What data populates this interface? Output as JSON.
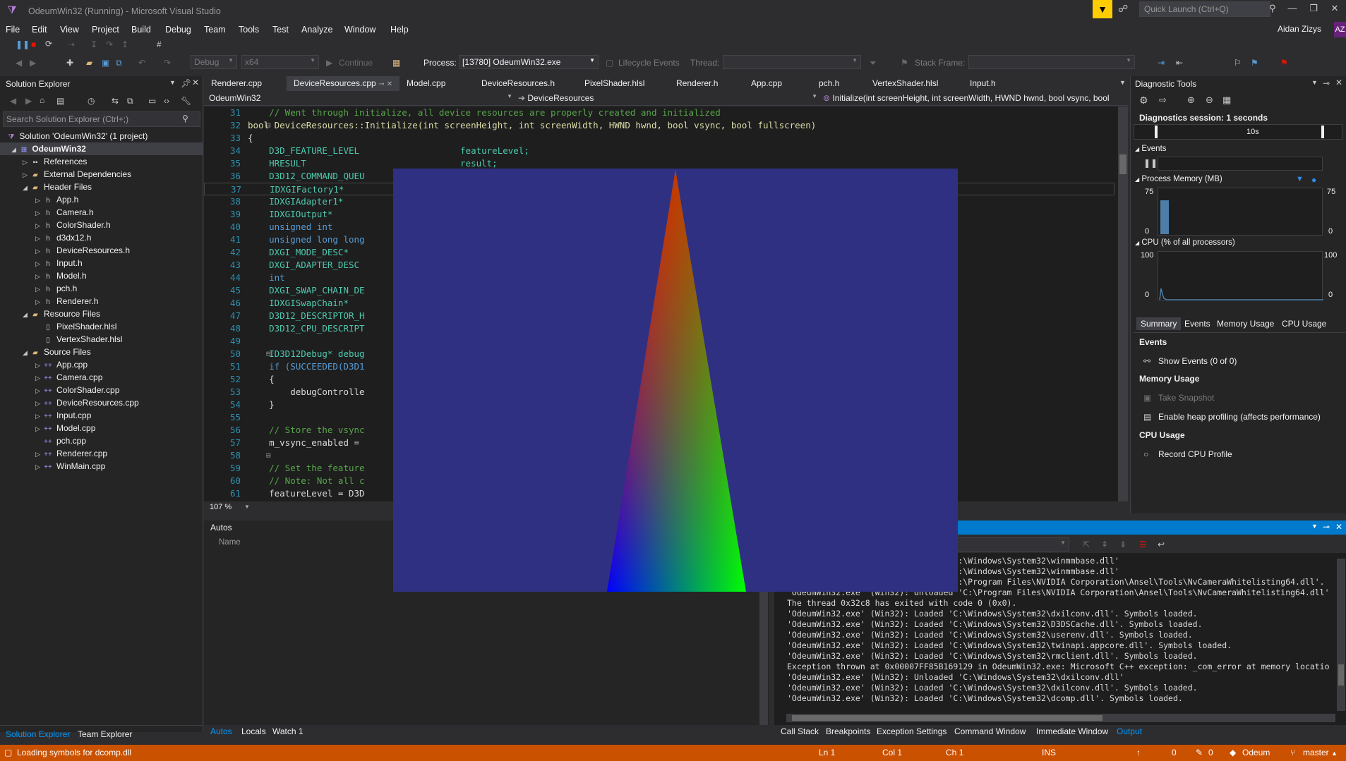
{
  "window": {
    "title": "OdeumWin32 (Running) - Microsoft Visual Studio",
    "quick_launch_placeholder": "Quick Launch (Ctrl+Q)",
    "user_name": "Aidan Zizys",
    "user_initials": "AZ"
  },
  "menu": [
    "File",
    "Edit",
    "View",
    "Project",
    "Build",
    "Debug",
    "Team",
    "Tools",
    "Test",
    "Analyze",
    "Window",
    "Help"
  ],
  "toolbar": {
    "config": "Debug",
    "platform": "x64",
    "continue_label": "Continue",
    "process_label": "Process:",
    "process_value": "[13780] OdeumWin32.exe",
    "lifecycle_label": "Lifecycle Events",
    "thread_label": "Thread:",
    "stack_frame_label": "Stack Frame:"
  },
  "solution_explorer": {
    "title": "Solution Explorer",
    "search_placeholder": "Search Solution Explorer (Ctrl+;)",
    "solution_label": "Solution 'OdeumWin32' (1 project)",
    "project_label": "OdeumWin32",
    "items": [
      {
        "label": "References",
        "indent": 2,
        "icon": "references-icon",
        "arrow": "▷"
      },
      {
        "label": "External Dependencies",
        "indent": 2,
        "icon": "external-deps-icon",
        "arrow": "▷"
      },
      {
        "label": "Header Files",
        "indent": 2,
        "icon": "folder-icon",
        "arrow": "◢"
      },
      {
        "label": "App.h",
        "indent": 3,
        "icon": "header-file-icon",
        "arrow": "▷"
      },
      {
        "label": "Camera.h",
        "indent": 3,
        "icon": "header-file-icon",
        "arrow": "▷"
      },
      {
        "label": "ColorShader.h",
        "indent": 3,
        "icon": "header-file-icon",
        "arrow": "▷"
      },
      {
        "label": "d3dx12.h",
        "indent": 3,
        "icon": "header-file-icon",
        "arrow": "▷"
      },
      {
        "label": "DeviceResources.h",
        "indent": 3,
        "icon": "header-file-icon",
        "arrow": "▷"
      },
      {
        "label": "Input.h",
        "indent": 3,
        "icon": "header-file-icon",
        "arrow": "▷"
      },
      {
        "label": "Model.h",
        "indent": 3,
        "icon": "header-file-icon",
        "arrow": "▷"
      },
      {
        "label": "pch.h",
        "indent": 3,
        "icon": "header-file-icon",
        "arrow": "▷"
      },
      {
        "label": "Renderer.h",
        "indent": 3,
        "icon": "header-file-icon",
        "arrow": "▷"
      },
      {
        "label": "Resource Files",
        "indent": 2,
        "icon": "folder-icon",
        "arrow": "◢"
      },
      {
        "label": "PixelShader.hlsl",
        "indent": 3,
        "icon": "hlsl-file-icon",
        "arrow": ""
      },
      {
        "label": "VertexShader.hlsl",
        "indent": 3,
        "icon": "hlsl-file-icon",
        "arrow": ""
      },
      {
        "label": "Source Files",
        "indent": 2,
        "icon": "folder-icon",
        "arrow": "◢"
      },
      {
        "label": "App.cpp",
        "indent": 3,
        "icon": "cpp-file-icon",
        "arrow": "▷"
      },
      {
        "label": "Camera.cpp",
        "indent": 3,
        "icon": "cpp-file-icon",
        "arrow": "▷"
      },
      {
        "label": "ColorShader.cpp",
        "indent": 3,
        "icon": "cpp-file-icon",
        "arrow": "▷"
      },
      {
        "label": "DeviceResources.cpp",
        "indent": 3,
        "icon": "cpp-file-icon",
        "arrow": "▷"
      },
      {
        "label": "Input.cpp",
        "indent": 3,
        "icon": "cpp-file-icon",
        "arrow": "▷"
      },
      {
        "label": "Model.cpp",
        "indent": 3,
        "icon": "cpp-file-icon",
        "arrow": "▷"
      },
      {
        "label": "pch.cpp",
        "indent": 3,
        "icon": "cpp-file-icon",
        "arrow": ""
      },
      {
        "label": "Renderer.cpp",
        "indent": 3,
        "icon": "cpp-file-icon",
        "arrow": "▷"
      },
      {
        "label": "WinMain.cpp",
        "indent": 3,
        "icon": "cpp-file-icon",
        "arrow": "▷"
      }
    ],
    "bottom_tabs": [
      "Solution Explorer",
      "Team Explorer"
    ]
  },
  "editor": {
    "tabs": [
      "Renderer.cpp",
      "DeviceResources.cpp",
      "Model.cpp",
      "DeviceResources.h",
      "PixelShader.hlsl",
      "Renderer.h",
      "App.cpp",
      "pch.h",
      "VertexShader.hlsl",
      "Input.h"
    ],
    "active_tab": 1,
    "nav_project": "OdeumWin32",
    "nav_class": "DeviceResources",
    "nav_member": "Initialize(int screenHeight, int screenWidth, HWND hwnd, bool vsync, bool",
    "zoom": "107 %",
    "lines": [
      {
        "n": "31",
        "t": "    // Went through initialize, all device resources are properly created and initialized",
        "c": "cm"
      },
      {
        "n": "32",
        "t": "bool DeviceResources::Initialize(int screenHeight, int screenWidth, HWND hwnd, bool vsync, bool fullscreen)",
        "c": "sig"
      },
      {
        "n": "33",
        "t": "{",
        "c": ""
      },
      {
        "n": "34",
        "t": "    D3D_FEATURE_LEVEL                   featureLevel;",
        "c": "ty"
      },
      {
        "n": "35",
        "t": "    HRESULT                             result;",
        "c": "ty"
      },
      {
        "n": "36",
        "t": "    D3D12_COMMAND_QUEU",
        "c": "ty"
      },
      {
        "n": "37",
        "t": "    IDXGIFactory1*",
        "c": "ty"
      },
      {
        "n": "38",
        "t": "    IDXGIAdapter1*",
        "c": "ty"
      },
      {
        "n": "39",
        "t": "    IDXGIOutput*",
        "c": "ty"
      },
      {
        "n": "40",
        "t": "    unsigned int",
        "c": "kw"
      },
      {
        "n": "41",
        "t": "    unsigned long long",
        "c": "kw"
      },
      {
        "n": "42",
        "t": "    DXGI_MODE_DESC*",
        "c": "ty"
      },
      {
        "n": "43",
        "t": "    DXGI_ADAPTER_DESC",
        "c": "ty"
      },
      {
        "n": "44",
        "t": "    int",
        "c": "kw"
      },
      {
        "n": "45",
        "t": "    DXGI_SWAP_CHAIN_DE",
        "c": "ty"
      },
      {
        "n": "46",
        "t": "    IDXGISwapChain*",
        "c": "ty"
      },
      {
        "n": "47",
        "t": "    D3D12_DESCRIPTOR_H",
        "c": "ty"
      },
      {
        "n": "48",
        "t": "    D3D12_CPU_DESCRIPT",
        "c": "ty"
      },
      {
        "n": "49",
        "t": "",
        "c": ""
      },
      {
        "n": "50",
        "t": "    ID3D12Debug* debug",
        "c": "ty"
      },
      {
        "n": "51",
        "t": "    if (SUCCEEDED(D3D1",
        "c": "if"
      },
      {
        "n": "52",
        "t": "    {",
        "c": ""
      },
      {
        "n": "53",
        "t": "        debugControlle",
        "c": "mv"
      },
      {
        "n": "54",
        "t": "    }",
        "c": ""
      },
      {
        "n": "55",
        "t": "",
        "c": ""
      },
      {
        "n": "56",
        "t": "    // Store the vsync",
        "c": "cm"
      },
      {
        "n": "57",
        "t": "    m_vsync_enabled = ",
        "c": "mv"
      },
      {
        "n": "58",
        "t": "",
        "c": ""
      },
      {
        "n": "59",
        "t": "    // Set the feature",
        "c": "cm"
      },
      {
        "n": "60",
        "t": "    // Note: Not all c",
        "c": "cm"
      },
      {
        "n": "61",
        "t": "    featureLevel = D3D",
        "c": "mv"
      }
    ]
  },
  "autos": {
    "title": "Autos",
    "column_name": "Name",
    "bottom_tabs": [
      "Autos",
      "Locals",
      "Watch 1"
    ]
  },
  "output": {
    "lines": [
      "'OdeumWin32.exe' (Win32): Loaded 'C:\\Windows\\System32\\winmmbase.dll'",
      "'OdeumWin32.exe' (Win32): Loaded 'C:\\Windows\\System32\\winmmbase.dll'",
      "'OdeumWin32.exe' (Win32): Loaded 'C:\\Program Files\\NVIDIA Corporation\\Ansel\\Tools\\NvCameraWhitelisting64.dll'.",
      "'OdeumWin32.exe' (Win32): Unloaded 'C:\\Program Files\\NVIDIA Corporation\\Ansel\\Tools\\NvCameraWhitelisting64.dll'",
      "The thread 0x32c8 has exited with code 0 (0x0).",
      "'OdeumWin32.exe' (Win32): Loaded 'C:\\Windows\\System32\\dxilconv.dll'. Symbols loaded.",
      "'OdeumWin32.exe' (Win32): Loaded 'C:\\Windows\\System32\\D3DSCache.dll'. Symbols loaded.",
      "'OdeumWin32.exe' (Win32): Loaded 'C:\\Windows\\System32\\userenv.dll'. Symbols loaded.",
      "'OdeumWin32.exe' (Win32): Loaded 'C:\\Windows\\System32\\twinapi.appcore.dll'. Symbols loaded.",
      "'OdeumWin32.exe' (Win32): Loaded 'C:\\Windows\\System32\\rmclient.dll'. Symbols loaded.",
      "Exception thrown at 0x00007FF85B169129 in OdeumWin32.exe: Microsoft C++ exception: _com_error at memory locatio",
      "'OdeumWin32.exe' (Win32): Unloaded 'C:\\Windows\\System32\\dxilconv.dll'",
      "'OdeumWin32.exe' (Win32): Loaded 'C:\\Windows\\System32\\dxilconv.dll'. Symbols loaded.",
      "'OdeumWin32.exe' (Win32): Loaded 'C:\\Windows\\System32\\dcomp.dll'. Symbols loaded."
    ],
    "bottom_tabs": [
      "Call Stack",
      "Breakpoints",
      "Exception Settings",
      "Command Window",
      "Immediate Window",
      "Output"
    ]
  },
  "diagnostics": {
    "title": "Diagnostic Tools",
    "session": "Diagnostics session: 1 seconds",
    "timeline_label": "10s",
    "events_label": "Events",
    "memory_label": "Process Memory (MB)",
    "memory_max": "75",
    "memory_min": "0",
    "memory_level": 0.75,
    "cpu_label": "CPU (% of all processors)",
    "cpu_max": "100",
    "cpu_min": "0",
    "tabs": [
      "Summary",
      "Events",
      "Memory Usage",
      "CPU Usage"
    ],
    "section_events": "Events",
    "show_events": "Show Events (0 of 0)",
    "section_memory": "Memory Usage",
    "take_snapshot": "Take Snapshot",
    "heap_profiling": "Enable heap profiling (affects performance)",
    "section_cpu": "CPU Usage",
    "record_cpu": "Record CPU Profile"
  },
  "status": {
    "message": "Loading symbols for dcomp.dll",
    "ln": "Ln 1",
    "col": "Col 1",
    "ch": "Ch 1",
    "ins": "INS",
    "up_count": "0",
    "edit_count": "0",
    "repo": "Odeum",
    "branch": "master"
  },
  "colors": {
    "accent": "#007acc",
    "status_bar": "#ca5100",
    "game_background": "#303082",
    "triangle_top": "#ff0000",
    "triangle_left": "#0000ff",
    "triangle_right": "#00ff00"
  }
}
